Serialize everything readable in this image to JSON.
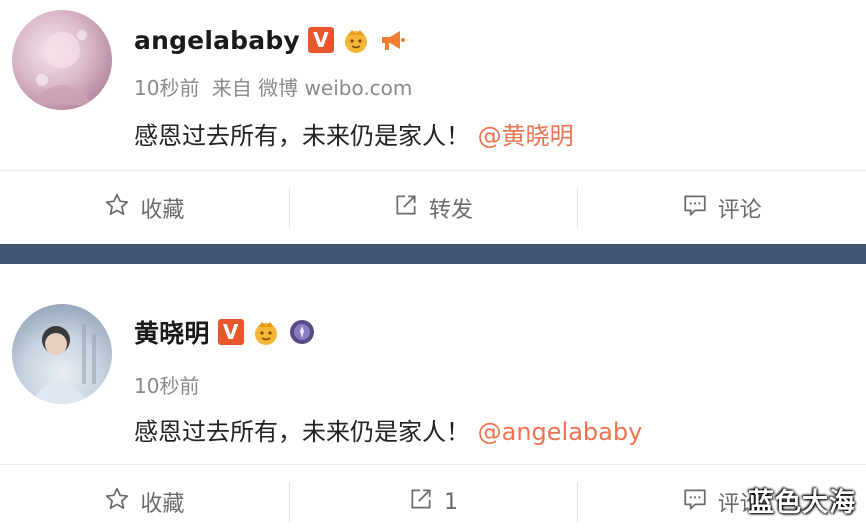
{
  "posts": [
    {
      "username": "angelababy",
      "verified_badge": "V",
      "badges": [
        "vip-crown-icon",
        "megaphone-icon"
      ],
      "time": "10秒前",
      "source": "来自 微博 weibo.com",
      "content_text": "感恩过去所有，未来仍是家人！",
      "mention": "@黄晓明",
      "actions": [
        {
          "icon": "star-icon",
          "label": "收藏"
        },
        {
          "icon": "repost-icon",
          "label": "转发"
        },
        {
          "icon": "comment-icon",
          "label": "评论"
        }
      ]
    },
    {
      "username": "黄晓明",
      "verified_badge": "V",
      "badges": [
        "vip-crown-icon",
        "medal-icon"
      ],
      "time": "10秒前",
      "source": "",
      "content_text": "感恩过去所有，未来仍是家人！",
      "mention": "@angelababy",
      "actions": [
        {
          "icon": "star-icon",
          "label": "收藏"
        },
        {
          "icon": "repost-icon",
          "label": "1"
        },
        {
          "icon": "comment-icon",
          "label": "评论"
        }
      ]
    }
  ],
  "watermark": "蓝色大海",
  "colors": {
    "mention": "#eb7350",
    "verified": "#e8572b",
    "section_bar": "#3f5573"
  }
}
